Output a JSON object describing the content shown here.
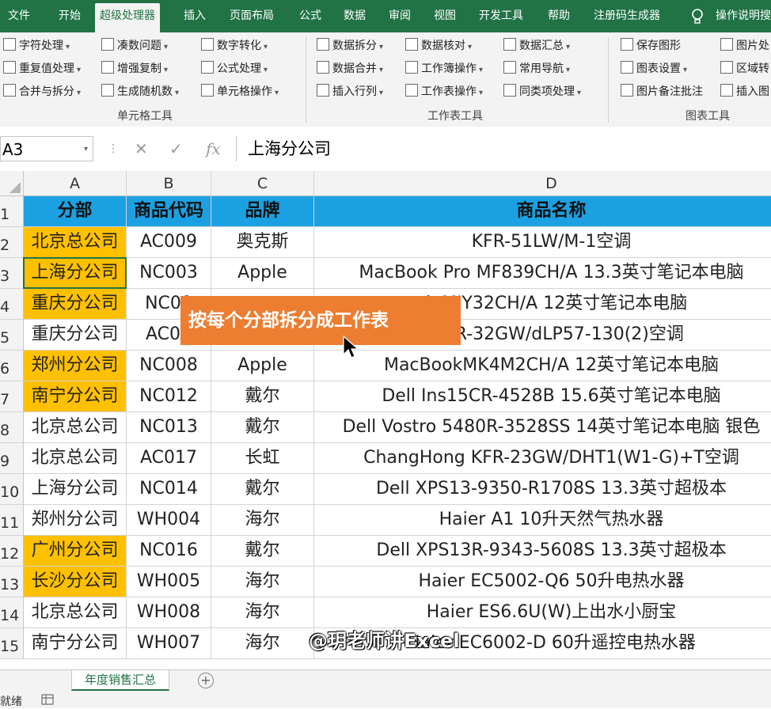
{
  "menu": {
    "tabs": [
      "文件",
      "开始",
      "超级处理器",
      "插入",
      "页面布局",
      "公式",
      "数据",
      "审阅",
      "视图",
      "开发工具",
      "帮助",
      "注册码生成器",
      "操作说明搜"
    ],
    "active": "超级处理器"
  },
  "ribbon": {
    "cell_tools": {
      "label": "单元格工具",
      "items": [
        "字符处理",
        "凑数问题",
        "数字转化",
        "重复值处理",
        "增强复制",
        "公式处理",
        "合并与拆分",
        "生成随机数",
        "单元格操作"
      ]
    },
    "sheet_tools": {
      "label": "工作表工具",
      "items": [
        "数据拆分",
        "数据核对",
        "数据汇总",
        "数据合并",
        "工作簿操作",
        "常用导航",
        "插入行列",
        "工作表操作",
        "同类项处理"
      ]
    },
    "chart_tools": {
      "label": "图表工具",
      "items": [
        "保存图形",
        "图片处",
        "图表设置",
        "区域转",
        "图片备注批注",
        "插入图"
      ]
    }
  },
  "formula_bar": {
    "name_box": "A3",
    "cancel_glyph": "✕",
    "enter_glyph": "✓",
    "fx_glyph": "fx",
    "content": "上海分公司"
  },
  "sheet": {
    "columns": [
      "A",
      "B",
      "C",
      "D"
    ],
    "rows": [
      "1",
      "2",
      "3",
      "4",
      "5",
      "6",
      "7",
      "8",
      "9",
      "10",
      "11",
      "12",
      "13",
      "14",
      "15"
    ],
    "header": [
      "分部",
      "商品代码",
      "品牌",
      "商品名称"
    ],
    "data": [
      {
        "dept": "北京总公司",
        "code": "AC009",
        "brand": "奥克斯",
        "name": "KFR-51LW/M-1空调",
        "hl": true
      },
      {
        "dept": "上海分公司",
        "code": "NC003",
        "brand": "Apple",
        "name": "MacBook Pro MF839CH/A 13.3英寸笔记本电脑",
        "hl": true
      },
      {
        "dept": "重庆分公司",
        "code": "NC00",
        "brand": "",
        "name": "ok MJY32CH/A 12英寸笔记本电脑",
        "hl": true
      },
      {
        "dept": "重庆分公司",
        "code": "AC07",
        "brand": "",
        "name": "z KFR-32GW/dLP57-130(2)空调",
        "hl": false
      },
      {
        "dept": "郑州分公司",
        "code": "NC008",
        "brand": "Apple",
        "name": "MacBookMK4M2CH/A 12英寸笔记本电脑",
        "hl": true
      },
      {
        "dept": "南宁分公司",
        "code": "NC012",
        "brand": "戴尔",
        "name": "Dell Ins15CR-4528B 15.6英寸笔记本电脑",
        "hl": true
      },
      {
        "dept": "北京总公司",
        "code": "NC013",
        "brand": "戴尔",
        "name": "Dell Vostro 5480R-3528SS 14英寸笔记本电脑 银色",
        "hl": false
      },
      {
        "dept": "北京总公司",
        "code": "AC017",
        "brand": "长虹",
        "name": "ChangHong KFR-23GW/DHT1(W1-G)+T空调",
        "hl": false
      },
      {
        "dept": "上海分公司",
        "code": "NC014",
        "brand": "戴尔",
        "name": "Dell XPS13-9350-R1708S 13.3英寸超极本",
        "hl": false
      },
      {
        "dept": "郑州分公司",
        "code": "WH004",
        "brand": "海尔",
        "name": "Haier A1 10升天然气热水器",
        "hl": false
      },
      {
        "dept": "广州分公司",
        "code": "NC016",
        "brand": "戴尔",
        "name": "Dell  XPS13R-9343-5608S 13.3英寸超极本",
        "hl": true
      },
      {
        "dept": "长沙分公司",
        "code": "WH005",
        "brand": "海尔",
        "name": "Haier EC5002-Q6 50升电热水器",
        "hl": true
      },
      {
        "dept": "北京总公司",
        "code": "WH008",
        "brand": "海尔",
        "name": "Haier ES6.6U(W)上出水小厨宝",
        "hl": false
      },
      {
        "dept": "南宁分公司",
        "code": "WH007",
        "brand": "海尔",
        "name": "Haier EC6002-D 60升遥控电热水器",
        "hl": false
      }
    ],
    "tab": "年度销售汇总",
    "add_sheet_glyph": "+"
  },
  "overlay": {
    "tooltip": "按每个分部拆分成工作表",
    "watermark": "@玥老师讲Excel"
  },
  "status": {
    "ready": "就绪"
  },
  "colors": {
    "ribbon_green": "#217346",
    "header_fill": "#1ba1e2",
    "highlight": "#ffc000",
    "tooltip": "#ed7d31"
  }
}
